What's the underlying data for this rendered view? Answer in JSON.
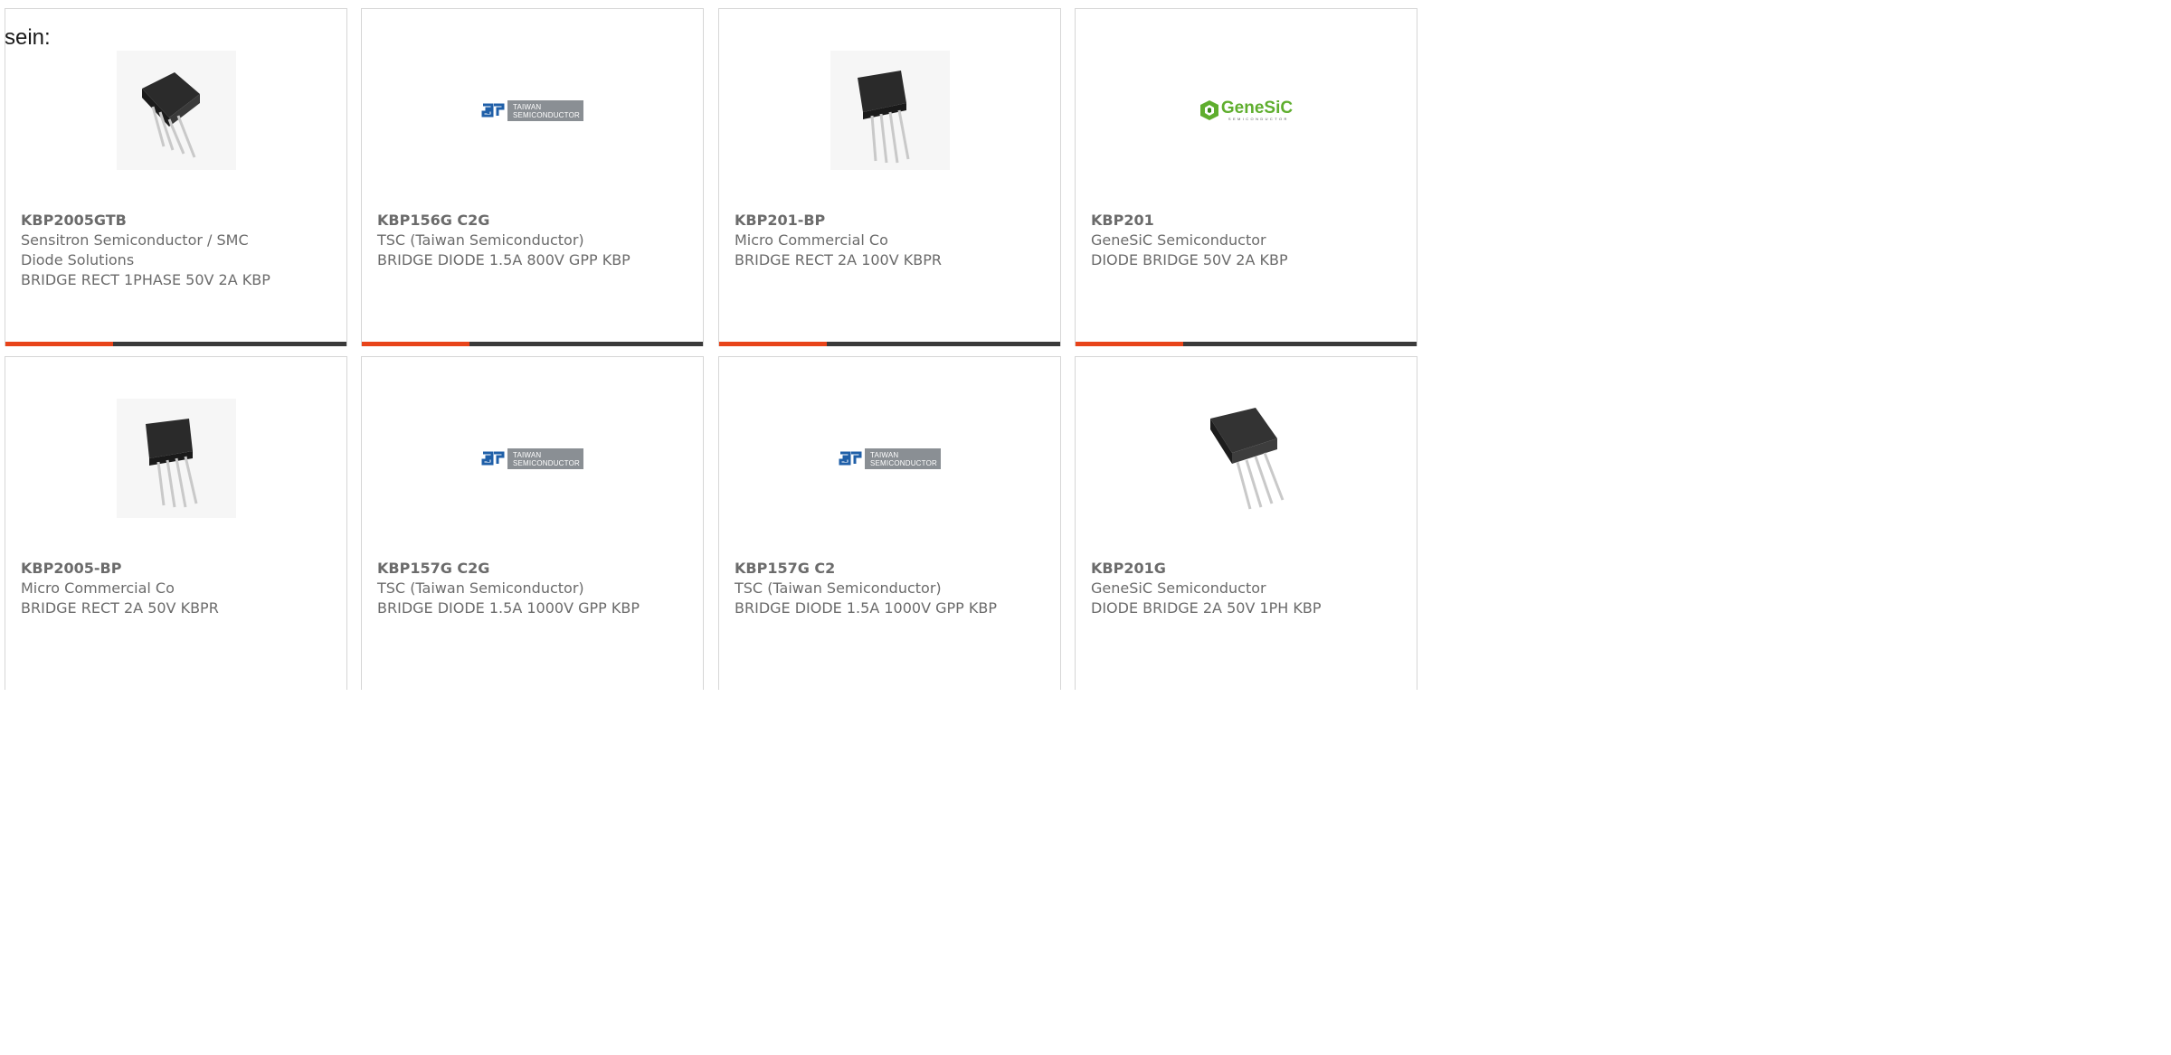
{
  "intro_text": "sein:",
  "colors": {
    "accent": "#e8441a",
    "bar": "#3a3a3a",
    "text": "#6b6b6b",
    "border": "#d6d6d6"
  },
  "cards": [
    {
      "part_number": "KBP2005GTB",
      "manufacturer": "Sensitron Semiconductor / SMC Diode Solutions",
      "description": "BRIDGE RECT 1PHASE 50V 2A KBP",
      "image_type": "bridge-rectifier-photo"
    },
    {
      "part_number": "KBP156G C2G",
      "manufacturer": "TSC (Taiwan Semiconductor)",
      "description": "BRIDGE DIODE 1.5A 800V GPP KBP",
      "image_type": "taiwan-semiconductor-logo",
      "logo_text": [
        "TAIWAN",
        "SEMICONDUCTOR"
      ]
    },
    {
      "part_number": "KBP201-BP",
      "manufacturer": "Micro Commercial Co",
      "description": "BRIDGE RECT 2A 100V KBPR",
      "image_type": "bridge-rectifier-photo"
    },
    {
      "part_number": "KBP201",
      "manufacturer": "GeneSiC Semiconductor",
      "description": "DIODE BRIDGE 50V 2A KBP",
      "image_type": "genesic-logo",
      "logo_text": [
        "GeneSiC",
        "SEMICONDUCTOR"
      ]
    },
    {
      "part_number": "KBP2005-BP",
      "manufacturer": "Micro Commercial Co",
      "description": "BRIDGE RECT 2A 50V KBPR",
      "image_type": "bridge-rectifier-photo"
    },
    {
      "part_number": "KBP157G C2G",
      "manufacturer": "TSC (Taiwan Semiconductor)",
      "description": "BRIDGE DIODE 1.5A 1000V GPP KBP",
      "image_type": "taiwan-semiconductor-logo",
      "logo_text": [
        "TAIWAN",
        "SEMICONDUCTOR"
      ]
    },
    {
      "part_number": "KBP157G C2",
      "manufacturer": "TSC (Taiwan Semiconductor)",
      "description": "BRIDGE DIODE 1.5A 1000V GPP KBP",
      "image_type": "taiwan-semiconductor-logo",
      "logo_text": [
        "TAIWAN",
        "SEMICONDUCTOR"
      ]
    },
    {
      "part_number": "KBP201G",
      "manufacturer": "GeneSiC Semiconductor",
      "description": "DIODE BRIDGE 2A 50V 1PH KBP",
      "image_type": "bridge-rectifier-photo"
    }
  ]
}
